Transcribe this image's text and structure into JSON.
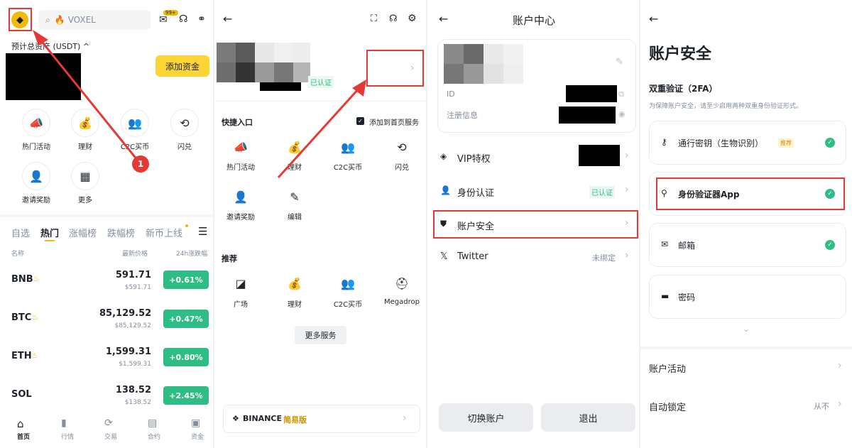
{
  "panel1": {
    "search_placeholder": "VOXEL",
    "notif_badge": "99+",
    "total_label": "预计总资产 (USDT) ^",
    "add_funds": "添加资金",
    "shortcuts": [
      "热门活动",
      "理财",
      "C2C买币",
      "闪兑",
      "邀请奖励",
      "更多"
    ],
    "marker": "1",
    "tabs": [
      "自选",
      "热门",
      "涨幅榜",
      "跌幅榜",
      "新币上线"
    ],
    "col_name": "名称",
    "col_price": "最新价格",
    "col_change": "24h涨跌幅",
    "rows": [
      {
        "sym": "BNB",
        "price": "591.71",
        "sub": "$591.71",
        "chg": "+0.61%"
      },
      {
        "sym": "BTC",
        "price": "85,129.52",
        "sub": "$85,129.52",
        "chg": "+0.47%"
      },
      {
        "sym": "ETH",
        "price": "1,599.31",
        "sub": "$1,599.31",
        "chg": "+0.80%"
      },
      {
        "sym": "SOL",
        "price": "138.52",
        "sub": "$138.52",
        "chg": "+2.45%"
      }
    ],
    "nav": [
      "首页",
      "行情",
      "交易",
      "合约",
      "资金"
    ]
  },
  "panel2": {
    "verified": "已认证",
    "quick_title": "快捷入口",
    "add_home": "添加到首页服务",
    "quick_items": [
      "热门活动",
      "理财",
      "C2C买币",
      "闪兑",
      "邀请奖励",
      "编辑"
    ],
    "rec_title": "推荐",
    "rec_items": [
      "广场",
      "理财",
      "C2C买币",
      "Megadrop"
    ],
    "more_services": "更多服务",
    "binance": "BINANCE",
    "lite": "简易版"
  },
  "panel3": {
    "title": "账户中心",
    "id_label": "ID",
    "reg_label": "注册信息",
    "menu": [
      {
        "label": "VIP特权",
        "value": ""
      },
      {
        "label": "身份认证",
        "value": "已认证"
      },
      {
        "label": "账户安全",
        "value": ""
      },
      {
        "label": "Twitter",
        "value": "未绑定"
      }
    ],
    "switch_btn": "切换账户",
    "logout_btn": "退出"
  },
  "panel4": {
    "title": "账户安全",
    "twofa": "双重验证（2FA）",
    "twofa_desc": "为保障账户安全，请至少启用两种双重身份验证形式。",
    "items": [
      {
        "label": "通行密钥（生物识别）",
        "badge": "推荐",
        "checked": true
      },
      {
        "label": "身份验证器App",
        "badge": "",
        "checked": true
      },
      {
        "label": "邮箱",
        "badge": "",
        "checked": true
      },
      {
        "label": "密码",
        "badge": "",
        "checked": false
      }
    ],
    "activity": "账户活动",
    "autolock": "自动锁定",
    "autolock_value": "从不"
  },
  "colors": {
    "brand": "#f0b90b",
    "green": "#2ebd85",
    "red": "#e53935"
  }
}
